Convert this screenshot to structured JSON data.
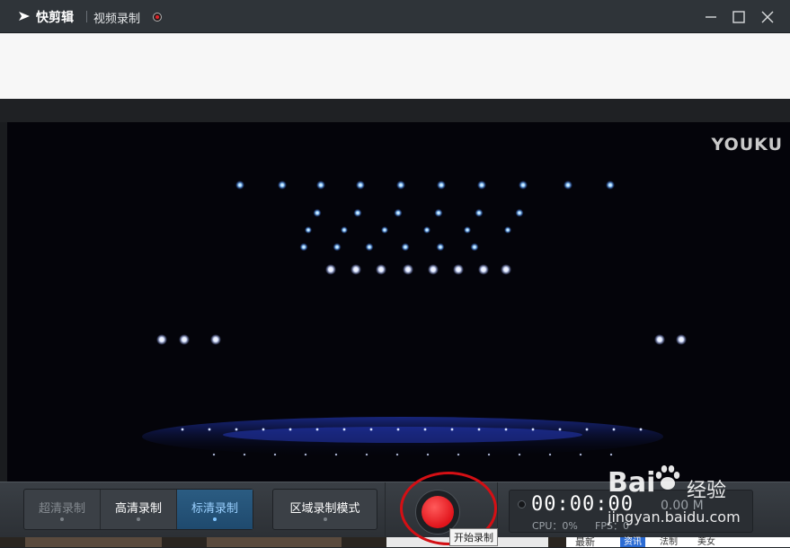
{
  "titlebar": {
    "app_name": "快剪辑",
    "mode_title": "视频录制",
    "icons": [
      "logo-icon",
      "record-indicator-icon",
      "minimize-icon",
      "maximize-icon",
      "close-icon"
    ]
  },
  "video": {
    "watermark": "YOUKU"
  },
  "toolbar": {
    "quality_buttons": [
      {
        "label": "超清录制",
        "state": "disabled"
      },
      {
        "label": "高清录制",
        "state": "normal"
      },
      {
        "label": "标清录制",
        "state": "selected"
      }
    ],
    "region_mode_label": "区域录制模式",
    "record_tooltip": "开始录制",
    "timer": "00:00:00",
    "size": "0.00 M",
    "cpu": "CPU：0%",
    "fps": "FPS：0"
  },
  "bottom": {
    "side_tabs": [
      "最新",
      "资讯",
      "法制",
      "美女"
    ]
  },
  "watermark_overlay": {
    "brand": "Bai",
    "product": "经验",
    "url": "jingyan.baidu.com"
  },
  "colors": {
    "accent": "#2b5c82",
    "record": "#e1141b",
    "annotation": "#d40f14"
  }
}
